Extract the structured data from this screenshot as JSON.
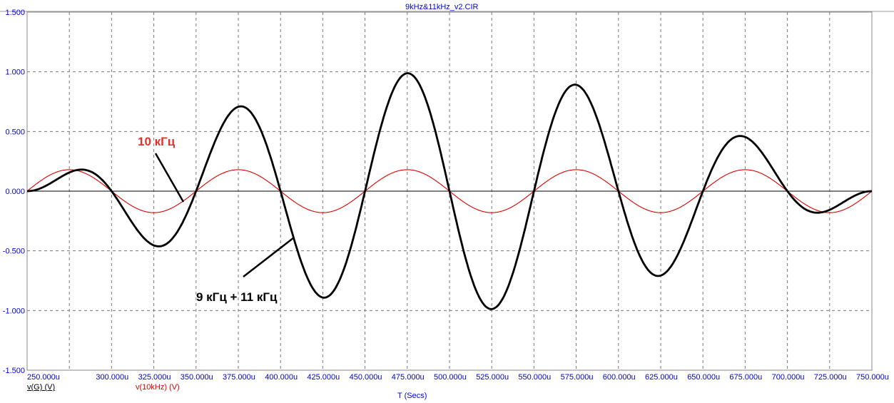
{
  "chart_data": {
    "type": "line",
    "title": "9kHz&11kHz_v2.CIR",
    "xlabel": "T (Secs)",
    "ylabel": "",
    "xlim": [
      250,
      750
    ],
    "x_unit": "u",
    "ylim": [
      -1.5,
      1.5
    ],
    "grid": true,
    "x_ticks": [
      250,
      275,
      300,
      325,
      350,
      375,
      400,
      425,
      450,
      475,
      500,
      525,
      550,
      575,
      600,
      625,
      650,
      675,
      700,
      725,
      750
    ],
    "x_tick_labels": [
      "250.000u",
      "",
      "300.000u",
      "325.000u",
      "350.000u",
      "375.000u",
      "400.000u",
      "425.000u",
      "450.000u",
      "475.000u",
      "500.000u",
      "525.000u",
      "550.000u",
      "575.000u",
      "600.000u",
      "625.000u",
      "650.000u",
      "675.000u",
      "700.000u",
      "725.000u",
      "750.000u"
    ],
    "y_ticks": [
      1.5,
      1.0,
      0.5,
      0.0,
      -0.5,
      -1.0,
      -1.5
    ],
    "y_tick_labels": [
      "1.500",
      "1.000",
      "0.500",
      "0.000",
      "-0.500",
      "-1.000",
      "-1.500"
    ],
    "series": [
      {
        "name": "v(G) (V)",
        "color": "#000000",
        "description": "sum of 9 kHz and 11 kHz sines",
        "components": [
          {
            "freq_khz": 9,
            "amplitude": 0.5
          },
          {
            "freq_khz": 11,
            "amplitude": 0.5
          }
        ],
        "peaks": [
          [
            270,
            0.18
          ],
          [
            328,
            -0.46
          ],
          [
            377,
            0.71
          ],
          [
            425,
            -0.89
          ],
          [
            475,
            0.99
          ],
          [
            525,
            -0.99
          ],
          [
            575,
            0.89
          ],
          [
            623,
            -0.71
          ],
          [
            672,
            0.46
          ],
          [
            720,
            -0.18
          ]
        ]
      },
      {
        "name": "v(10kHz) (V)",
        "color": "#e00000",
        "description": "10 kHz sine",
        "components": [
          {
            "freq_khz": 10,
            "amplitude": -0.18
          }
        ]
      }
    ],
    "annotations": [
      {
        "text": "10 кГц",
        "color": "#e8302a"
      },
      {
        "text": "9 кГц + 11 кГц",
        "color": "#000000"
      }
    ]
  }
}
